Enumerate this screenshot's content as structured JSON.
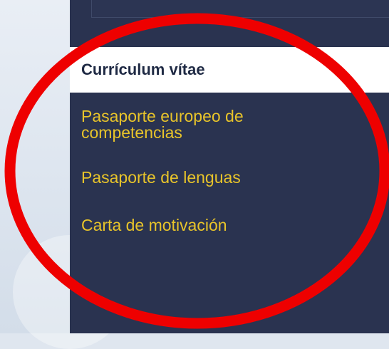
{
  "sidebar": {
    "items": [
      {
        "label": "Currículum vítae",
        "active": true
      },
      {
        "label_line1": "Pasaporte europeo de",
        "label_line2": "competencias"
      },
      {
        "label": "Pasaporte de lenguas"
      },
      {
        "label": "Carta de motivación"
      }
    ]
  },
  "colors": {
    "sidebar_bg": "#2a3350",
    "link": "#e8c42a",
    "active_bg": "#ffffff",
    "active_text": "#1f2a44",
    "annotation": "#ee0000"
  }
}
